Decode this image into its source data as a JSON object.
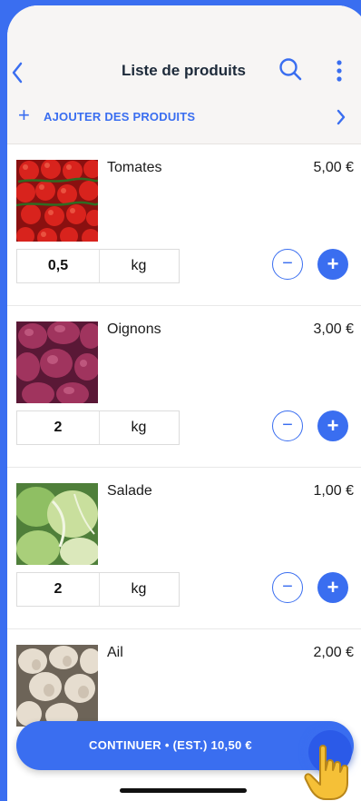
{
  "header": {
    "title": "Liste de produits"
  },
  "add_bar": {
    "label": "AJOUTER DES PRODUITS"
  },
  "products": [
    {
      "name": "Tomates",
      "price": "5,00 €",
      "qty": "0,5",
      "unit": "kg",
      "image": "tomatoes-image"
    },
    {
      "name": "Oignons",
      "price": "3,00 €",
      "qty": "2",
      "unit": "kg",
      "image": "onions-image"
    },
    {
      "name": "Salade",
      "price": "1,00 €",
      "qty": "2",
      "unit": "kg",
      "image": "lettuce-image"
    },
    {
      "name": "Ail",
      "price": "2,00 €",
      "image": "garlic-image"
    }
  ],
  "cta": {
    "label": "CONTINUER • (EST.) 10,50 €"
  },
  "colors": {
    "accent": "#3a6ef0",
    "background": "#3a6ef0",
    "header_bg": "#f7f5f4"
  },
  "icons": [
    "back-chevron-icon",
    "search-icon",
    "more-vertical-icon",
    "plus-icon",
    "chevron-right-icon",
    "minus-icon",
    "hand-pointer-icon"
  ]
}
